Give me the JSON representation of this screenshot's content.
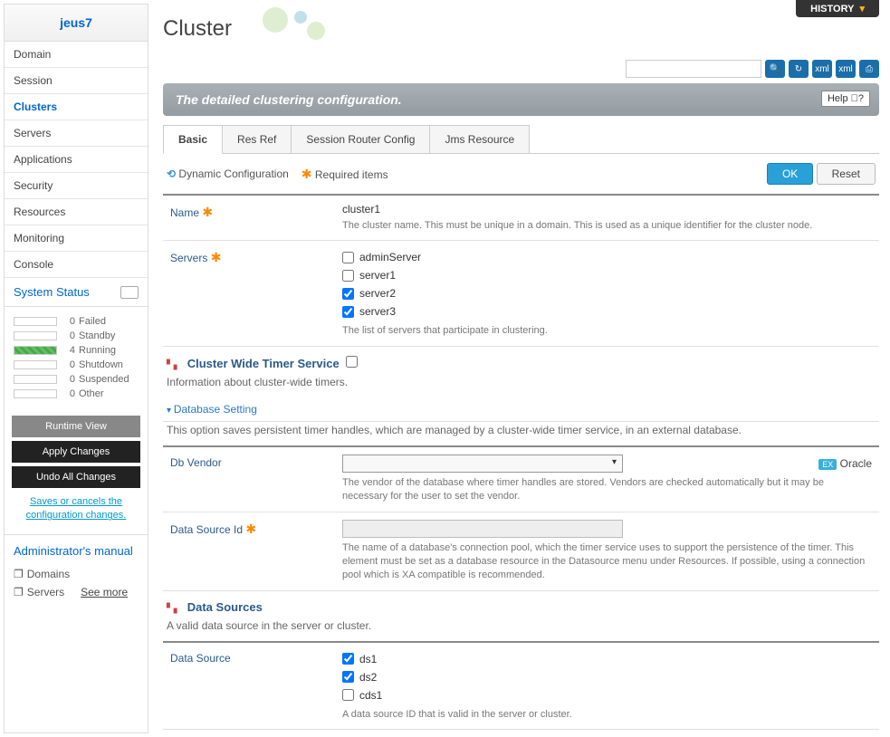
{
  "brand": "jeus7",
  "nav": [
    "Domain",
    "Session",
    "Clusters",
    "Servers",
    "Applications",
    "Security",
    "Resources",
    "Monitoring",
    "Console"
  ],
  "nav_active": "Clusters",
  "system_status": {
    "title": "System Status",
    "items": [
      {
        "count": 0,
        "label": "Failed"
      },
      {
        "count": 0,
        "label": "Standby"
      },
      {
        "count": 4,
        "label": "Running"
      },
      {
        "count": 0,
        "label": "Shutdown"
      },
      {
        "count": 0,
        "label": "Suspended"
      },
      {
        "count": 0,
        "label": "Other"
      }
    ]
  },
  "sidebar_buttons": {
    "runtime": "Runtime View",
    "apply": "Apply Changes",
    "undo": "Undo All Changes",
    "save_link": "Saves or cancels the configuration changes."
  },
  "admin_manual": {
    "title": "Administrator's manual",
    "items": [
      "Domains",
      "Servers"
    ],
    "see_more": "See more"
  },
  "page_title": "Cluster",
  "history": "HISTORY",
  "banner": "The detailed clustering configuration.",
  "help": "Help",
  "tabs": [
    "Basic",
    "Res Ref",
    "Session Router Config",
    "Jms Resource"
  ],
  "tab_active": "Basic",
  "legend": {
    "dynamic": "Dynamic Configuration",
    "required": "Required items",
    "ok": "OK",
    "reset": "Reset"
  },
  "form": {
    "name": {
      "label": "Name",
      "value": "cluster1",
      "desc": "The cluster name. This must be unique in a domain. This is used as a unique identifier for the cluster node."
    },
    "servers": {
      "label": "Servers",
      "options": [
        {
          "label": "adminServer",
          "checked": false
        },
        {
          "label": "server1",
          "checked": false
        },
        {
          "label": "server2",
          "checked": true
        },
        {
          "label": "server3",
          "checked": true
        }
      ],
      "desc": "The list of servers that participate in clustering."
    },
    "timer_section": {
      "title": "Cluster Wide Timer Service",
      "desc": "Information about cluster-wide timers."
    },
    "db_setting": {
      "title": "Database Setting",
      "desc": "This option saves persistent timer handles, which are managed by a cluster-wide timer service, in an external database."
    },
    "db_vendor": {
      "label": "Db Vendor",
      "example": "Oracle",
      "desc": "The vendor of the database where timer handles are stored. Vendors are checked automatically but it may be necessary for the user to set the vendor."
    },
    "data_source_id": {
      "label": "Data Source Id",
      "desc": "The name of a database's connection pool, which the timer service uses to support the persistence of the timer. This element must be set as a database resource in the Datasource menu under Resources. If possible, using a connection pool which is XA compatible is recommended."
    },
    "data_sources_section": {
      "title": "Data Sources",
      "desc": "A valid data source in the server or cluster."
    },
    "data_source": {
      "label": "Data Source",
      "options": [
        {
          "label": "ds1",
          "checked": true
        },
        {
          "label": "ds2",
          "checked": true
        },
        {
          "label": "cds1",
          "checked": false
        }
      ],
      "desc": "A data source ID that is valid in the server or cluster."
    }
  }
}
